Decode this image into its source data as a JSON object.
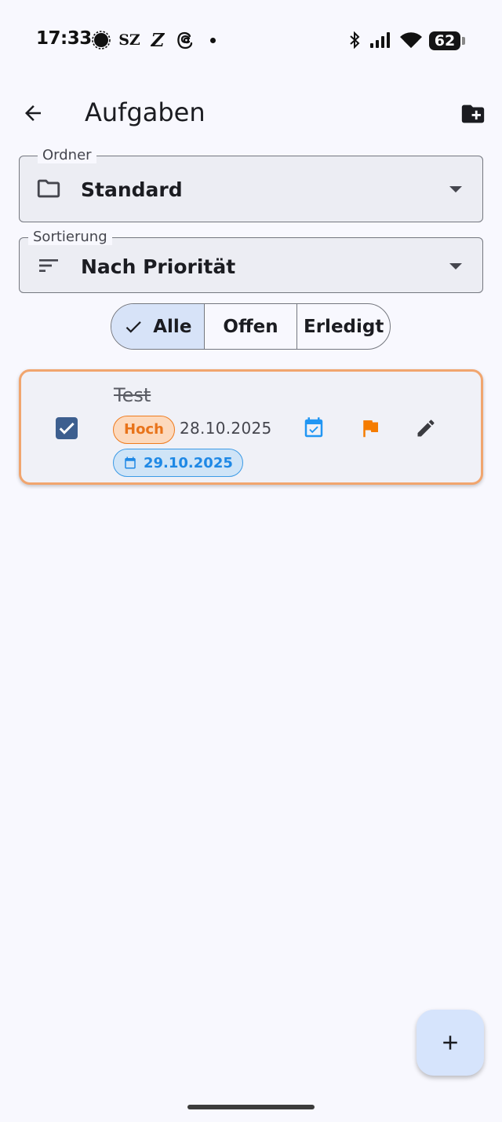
{
  "status_bar": {
    "time": "17:33",
    "app_icons": [
      "signal-messenger-icon",
      "sz-app-icon",
      "zeit-app-icon",
      "threads-icon"
    ],
    "sz_text": "SZ",
    "z_text": "Z",
    "battery": "62"
  },
  "app_bar": {
    "title": "Aufgaben",
    "back_icon": "arrow-back-icon",
    "action_icon": "create-new-folder-icon"
  },
  "folder_field": {
    "label": "Ordner",
    "value": "Standard",
    "icon": "folder-icon"
  },
  "sort_field": {
    "label": "Sortierung",
    "value": "Nach Priorität",
    "icon": "sort-icon"
  },
  "filter": {
    "options": [
      "Alle",
      "Offen",
      "Erledigt"
    ],
    "selected": "Alle"
  },
  "tasks": [
    {
      "title": "Test",
      "done": true,
      "priority": "Hoch",
      "created": "28.10.2025",
      "due": "29.10.2025"
    }
  ],
  "colors": {
    "accent": "#3d5f8f",
    "priority_high": "#ef7b1e",
    "due_blue": "#1e88e5",
    "card_border": "#f1a56e"
  },
  "fab": {
    "icon": "add-icon"
  }
}
